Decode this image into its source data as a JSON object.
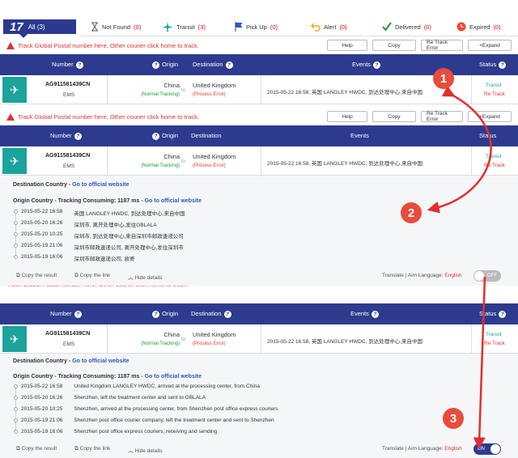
{
  "tabs": [
    {
      "label": "All",
      "count": "(3)",
      "big": "17"
    },
    {
      "label": "Not Found",
      "count": "(0)"
    },
    {
      "label": "Transit",
      "count": "(3)"
    },
    {
      "label": "Pick Up",
      "count": "(0)"
    },
    {
      "label": "Alert",
      "count": "(0)"
    },
    {
      "label": "Delivered",
      "count": "(0)"
    },
    {
      "label": "Expired",
      "count": "(0)"
    }
  ],
  "warning": "Track Global Postal number here, Other courier click home to track.",
  "actions": {
    "help": "Help",
    "copy": "Copy",
    "retrack": "Re Track Error",
    "expand": "Expand"
  },
  "table_headers": {
    "number": "Number",
    "origin": "Origin",
    "destination": "Destination",
    "events": "Events",
    "status": "Status"
  },
  "shipment": {
    "number": "AG911581439CN",
    "carrier": "EMS",
    "origin": "China",
    "origin_status": "(Normal Tracking)",
    "to": "to",
    "destination": "United Kingdom",
    "destination_status": "(Process Error)",
    "event": "2015-05-22 16:58, 英国 LANGLEY HWDC, 到达处理中心,来自中国",
    "status": "Transit",
    "retrack": "Re Track"
  },
  "detail": {
    "dest_country": "Destination Country",
    "origin_country": "Origin Country - Tracking Consuming: 1187 ms",
    "sep": " - ",
    "official": "Go to official website",
    "events_cn": [
      {
        "time": "2015-05-22 16:58",
        "desc": "英国 LANGLEY HWDC, 到达处理中心,来自中国"
      },
      {
        "time": "2015-05-20 16:26",
        "desc": "深圳市, 离开处理中心,发往GBLALA"
      },
      {
        "time": "2015-05-20 10:25",
        "desc": "深圳市, 到达处理中心,来自深圳市邮政速递公司"
      },
      {
        "time": "2015-05-19 21:06",
        "desc": "深圳市邮政速递公司, 离开处理中心,发往深圳市"
      },
      {
        "time": "2015-05-19 16:06",
        "desc": "深圳市邮政速递公司, 收寄"
      }
    ],
    "events_en": [
      {
        "time": "2015-05-22 16:58",
        "desc": "United Kingdom LANGLEY HWDC, arrived at the processing center, from China"
      },
      {
        "time": "2015-05-20 16:26",
        "desc": "Shenzhen, left the treatment center and sent to GBLALA"
      },
      {
        "time": "2015-05-20 10:25",
        "desc": "Shenzhen, arrived at the processing center, from Shenzhen post office express couriers"
      },
      {
        "time": "2015-05-19 21:06",
        "desc": "Shenzhen post office courier company, left the treatment center and sent to Shenzhen"
      },
      {
        "time": "2015-05-19 16:06",
        "desc": "Shenzhen post office express couriers, receiving and sending"
      }
    ],
    "copy_result": "Copy the result",
    "copy_link": "Copy the link",
    "hide": "Hide details",
    "translate": "Translate | Aim Language: ",
    "language": "English",
    "toggle_off": "OFF",
    "toggle_on": "ON"
  },
  "badges": [
    "1",
    "2",
    "3"
  ],
  "colors": {
    "header": "#2d3b8f",
    "accent": "#1ba39c",
    "alert": "#e74c3c"
  }
}
